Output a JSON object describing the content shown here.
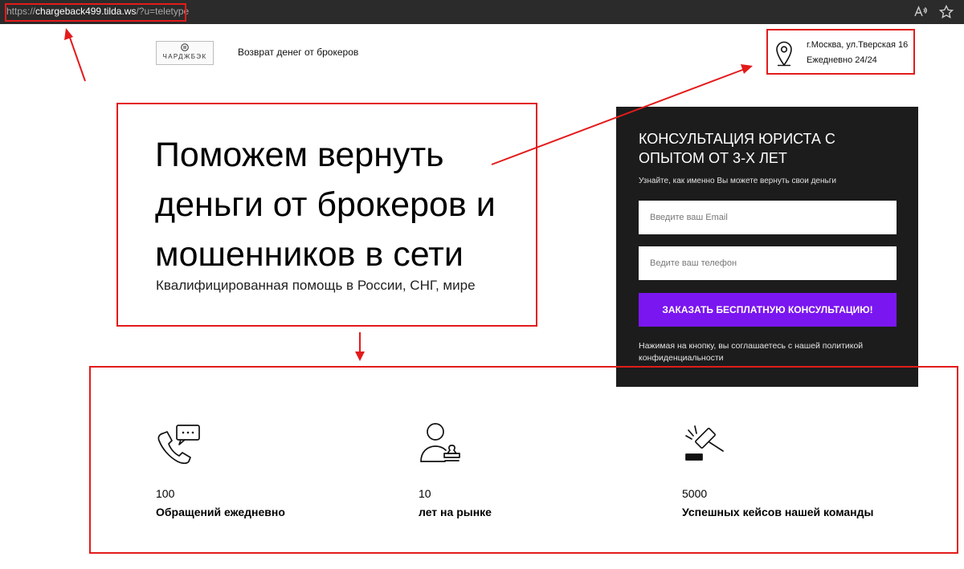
{
  "browser": {
    "url_protocol": "https://",
    "url_host": "chargeback499.tilda.ws",
    "url_path": "/?u=teletype",
    "icons": [
      "read-aloud-icon",
      "favorite-star-icon"
    ]
  },
  "header": {
    "logo_text": "ЧАРДЖБЭК",
    "tagline": "Возврат денег от брокеров",
    "address_line1": "г.Москва, ул.Тверская 16",
    "address_line2": "Ежедневно 24/24"
  },
  "hero": {
    "title_lines": [
      "Поможем вернуть",
      "деньги от брокеров и",
      "мошенников в сети"
    ],
    "subtitle": "Квалифицированная помощь в России, СНГ, мире"
  },
  "form": {
    "title_lines": [
      "КОНСУЛЬТАЦИЯ ЮРИСТА С",
      "ОПЫТОМ ОТ 3-Х ЛЕТ"
    ],
    "description": "Узнайте, как именно Вы можете вернуть свои деньги",
    "email_placeholder": "Введите ваш Email",
    "phone_placeholder": "Ведите ваш телефон",
    "submit_label": "ЗАКАЗАТЬ БЕСПЛАТНУЮ КОНСУЛЬТАЦИЮ!",
    "consent_note": "Нажимая на кнопку, вы соглашаетесь с нашей политикой конфиденциальности"
  },
  "stats": [
    {
      "icon": "phone-chat-icon",
      "value": "100",
      "label": "Обращений ежедневно"
    },
    {
      "icon": "lawyer-stamp-icon",
      "value": "10",
      "label": "лет на рынке"
    },
    {
      "icon": "gavel-icon",
      "value": "5000",
      "label": "Успешных кейсов нашей команды"
    }
  ],
  "colors": {
    "accent": "#7a16f0",
    "card_background": "#1c1c1c",
    "annotation": "#e31b1b"
  }
}
